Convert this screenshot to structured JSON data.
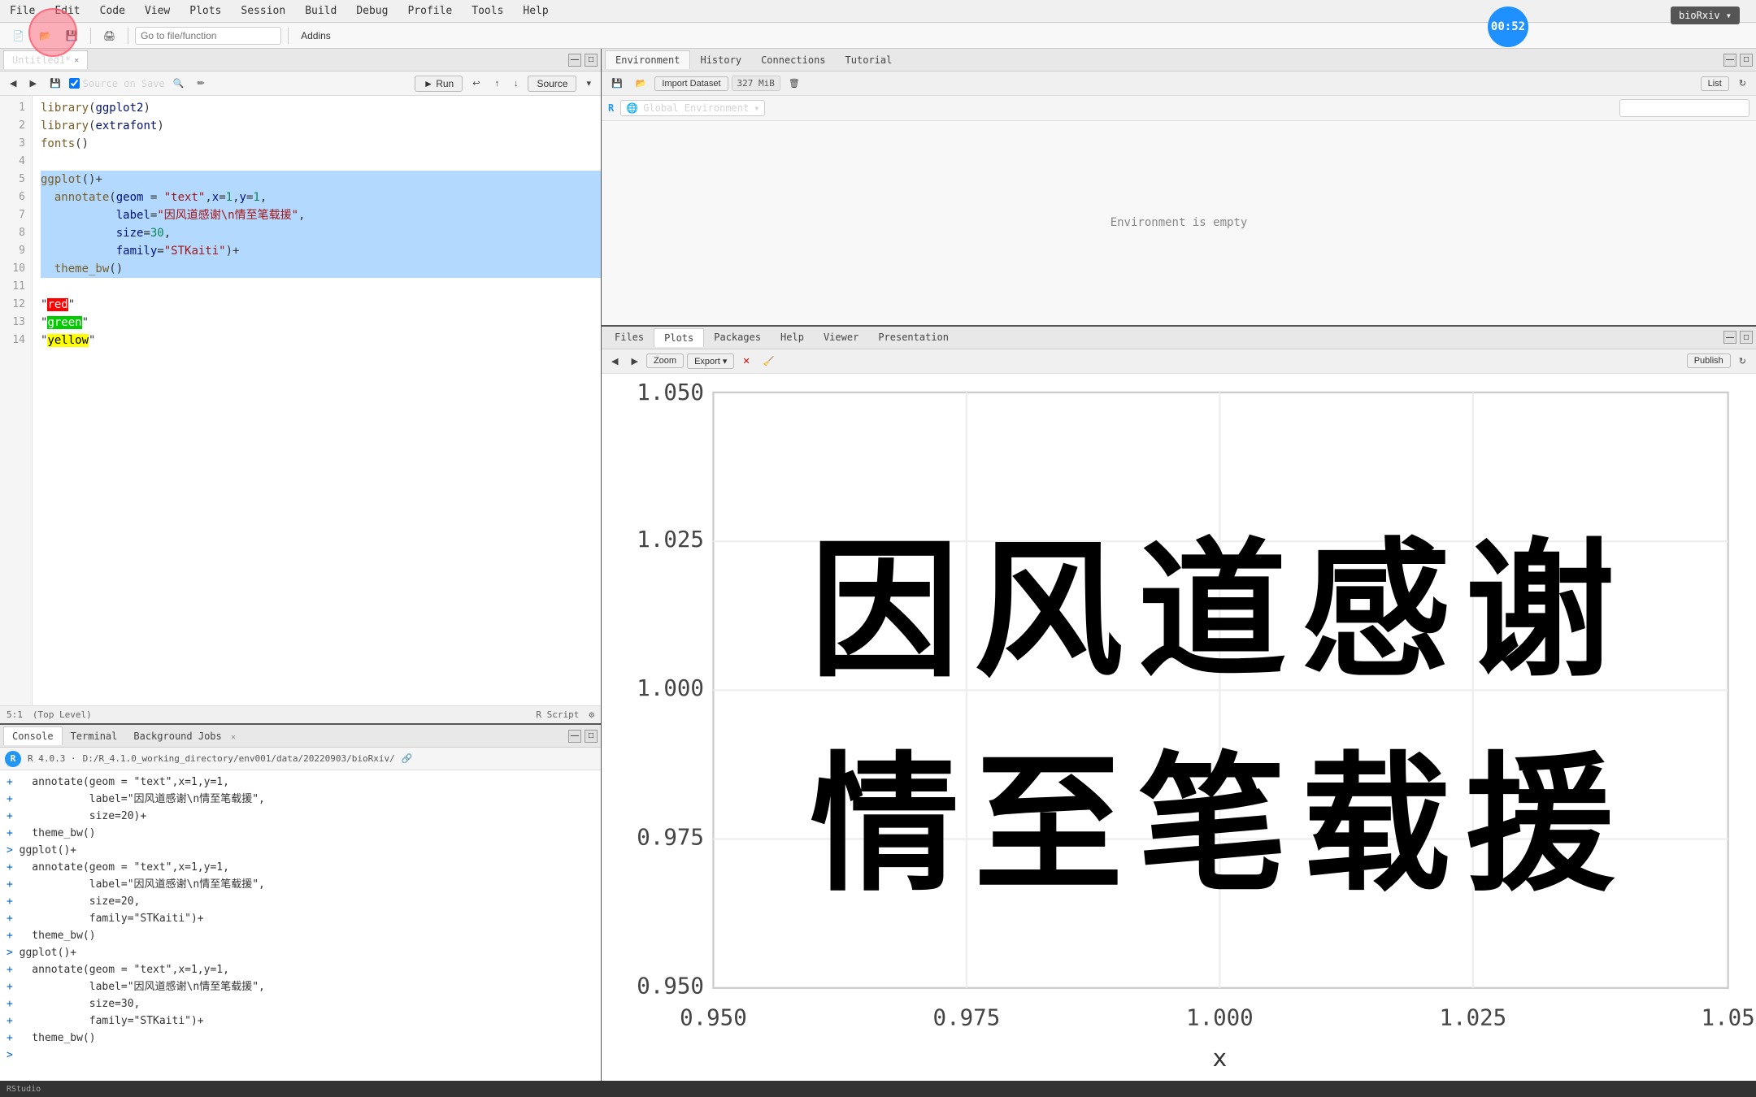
{
  "menu": {
    "items": [
      "File",
      "Edit",
      "Code",
      "View",
      "Plots",
      "Session",
      "Build",
      "Debug",
      "Profile",
      "Tools",
      "Help"
    ]
  },
  "toolbar": {
    "goto_placeholder": "Go to file/function",
    "addins_label": "Addins"
  },
  "timer": "00:52",
  "biorfxiv": "bioRxiv ▾",
  "editor": {
    "tab_label": "Untitled1*",
    "source_on_save": "Source on Save",
    "run_label": "► Run",
    "source_label": "Source",
    "status_position": "5:1",
    "status_level": "(Top Level)",
    "status_type": "R Script",
    "code_lines": [
      {
        "num": 1,
        "text": "library(ggplot2)",
        "selected": false
      },
      {
        "num": 2,
        "text": "library(extrafont)",
        "selected": false
      },
      {
        "num": 3,
        "text": "fonts()",
        "selected": false
      },
      {
        "num": 4,
        "text": "",
        "selected": false
      },
      {
        "num": 5,
        "text": "ggplot()+",
        "selected": true
      },
      {
        "num": 6,
        "text": "  annotate(geom = \"text\",x=1,y=1,",
        "selected": true
      },
      {
        "num": 7,
        "text": "           label=\"因风道感谢\\n情至笔载援\",",
        "selected": true
      },
      {
        "num": 8,
        "text": "           size=30,",
        "selected": true
      },
      {
        "num": 9,
        "text": "           family=\"STKaiti\")+",
        "selected": true
      },
      {
        "num": 10,
        "text": "  theme_bw()",
        "selected": true
      },
      {
        "num": 11,
        "text": "",
        "selected": false
      },
      {
        "num": 12,
        "text": "\"red\"",
        "selected": false,
        "special": "red"
      },
      {
        "num": 13,
        "text": "\"green\"",
        "selected": false,
        "special": "green"
      },
      {
        "num": 14,
        "text": "\"yellow\"",
        "selected": false,
        "special": "yellow"
      }
    ]
  },
  "console": {
    "tabs": [
      "Console",
      "Terminal",
      "Background Jobs"
    ],
    "active_tab": "Console",
    "r_version": "R 4.0.3",
    "working_dir": "D:/R_4.1.0_working_directory/env001/data/20220903/bioRxiv/",
    "lines": [
      {
        "type": "plus",
        "text": "  annotate(geom = \"text\",x=1,y=1,"
      },
      {
        "type": "plus",
        "text": "           label=\"因风道感谢\\n情至笔载援\","
      },
      {
        "type": "plus",
        "text": "           size=20)+"
      },
      {
        "type": "plus",
        "text": "  theme_bw()"
      },
      {
        "type": "prompt",
        "text": "ggplot()+"
      },
      {
        "type": "plus",
        "text": "  annotate(geom = \"text\",x=1,y=1,"
      },
      {
        "type": "plus",
        "text": "           label=\"因风道感谢\\n情至笔载援\","
      },
      {
        "type": "plus",
        "text": "           size=20,"
      },
      {
        "type": "plus",
        "text": "           family=\"STKaiti\")+"
      },
      {
        "type": "plus",
        "text": "  theme_bw()"
      },
      {
        "type": "prompt",
        "text": "ggplot()+"
      },
      {
        "type": "plus",
        "text": "  annotate(geom = \"text\",x=1,y=1,"
      },
      {
        "type": "plus",
        "text": "           label=\"因风道感谢\\n情至笔载援\","
      },
      {
        "type": "plus",
        "text": "           size=30,"
      },
      {
        "type": "plus",
        "text": "           family=\"STKaiti\")+"
      },
      {
        "type": "plus",
        "text": "  theme_bw()"
      },
      {
        "type": "prompt",
        "text": ""
      }
    ]
  },
  "environment": {
    "tabs": [
      "Environment",
      "History",
      "Connections",
      "Tutorial"
    ],
    "active_tab": "Environment",
    "import_label": "Import Dataset",
    "memory": "327 MiB",
    "list_label": "List",
    "global_env": "Global Environment",
    "empty_message": "Environment is empty",
    "search_placeholder": ""
  },
  "plots": {
    "tabs": [
      "Files",
      "Plots",
      "Packages",
      "Help",
      "Viewer",
      "Presentation"
    ],
    "active_tab": "Plots",
    "zoom_label": "Zoom",
    "export_label": "Export",
    "publish_label": "Publish",
    "y_axis_labels": [
      "1.050",
      "1.025",
      "1.000",
      "0.975",
      "0.950"
    ],
    "x_axis_labels": [
      "0.950",
      "0.975",
      "1.000",
      "1.025",
      "1.05"
    ],
    "x_axis_title": "x",
    "chinese_line1": "因 风 道 感 谢",
    "chinese_line2": "情 至 笔 载 援"
  }
}
